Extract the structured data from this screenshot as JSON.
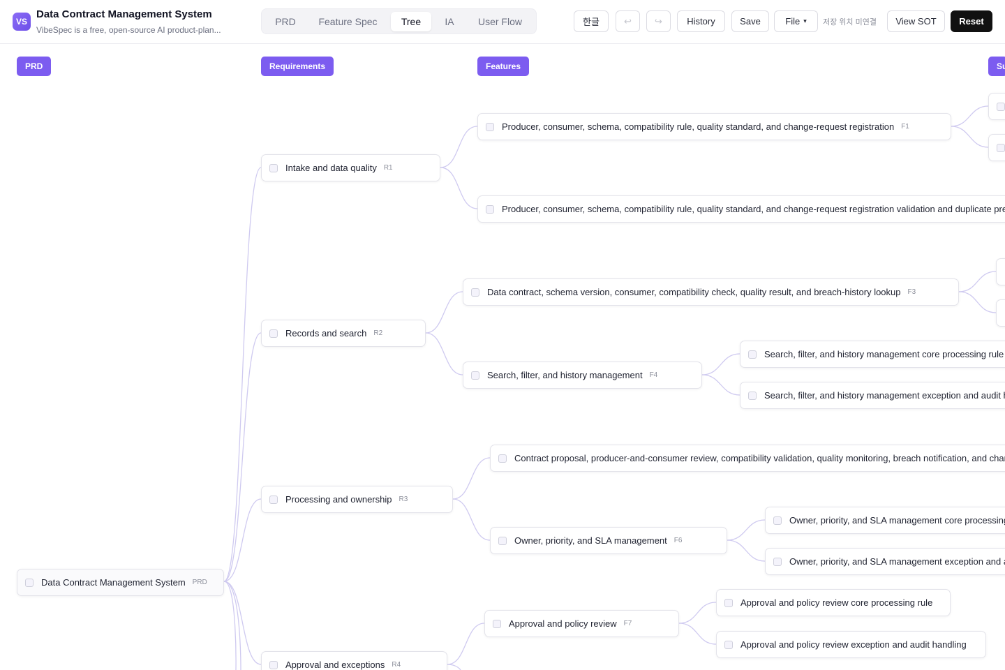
{
  "app": {
    "logo_text": "VS",
    "title": "Data Contract Management System",
    "subtitle": "VibeSpec is a free, open-source AI product-plan..."
  },
  "tabs": [
    {
      "label": "PRD"
    },
    {
      "label": "Feature Spec"
    },
    {
      "label": "Tree",
      "active": true
    },
    {
      "label": "IA"
    },
    {
      "label": "User Flow"
    }
  ],
  "toolbar": {
    "language_label": "한글",
    "undo_icon": "↩",
    "redo_icon": "↪",
    "history_label": "History",
    "save_label": "Save",
    "file_label": "File",
    "file_caret": "▾",
    "save_location_status": "저장 위치 미연결",
    "view_sot_label": "View SOT",
    "reset_label": "Reset"
  },
  "columns": {
    "prd": "PRD",
    "requirements": "Requirements",
    "features": "Features",
    "sub": "Su"
  },
  "tree": {
    "root": {
      "label": "Data Contract Management System",
      "tag": "PRD"
    },
    "requirements": [
      {
        "label": "Intake and data quality",
        "tag": "R1"
      },
      {
        "label": "Records and search",
        "tag": "R2"
      },
      {
        "label": "Processing and ownership",
        "tag": "R3"
      },
      {
        "label": "Approval and exceptions",
        "tag": "R4"
      }
    ],
    "features": [
      {
        "label": "Producer, consumer, schema, compatibility rule, quality standard, and change-request registration",
        "tag": "F1"
      },
      {
        "label": "Producer, consumer, schema, compatibility rule, quality standard, and change-request registration validation and duplicate prev",
        "tag": ""
      },
      {
        "label": "Data contract, schema version, consumer, compatibility check, quality result, and breach-history lookup",
        "tag": "F3"
      },
      {
        "label": "Search, filter, and history management",
        "tag": "F4"
      },
      {
        "label": "Contract proposal, producer-and-consumer review, compatibility validation, quality monitoring, breach notification, and char",
        "tag": ""
      },
      {
        "label": "Owner, priority, and SLA management",
        "tag": "F6"
      },
      {
        "label": "Approval and policy review",
        "tag": "F7"
      }
    ],
    "subfeatures": [
      {
        "label": "Search, filter, and history management core processing rule"
      },
      {
        "label": "Search, filter, and history management exception and audit h"
      },
      {
        "label": "Owner, priority, and SLA management core processing"
      },
      {
        "label": "Owner, priority, and SLA management exception and au"
      },
      {
        "label": "Approval and policy review core processing rule"
      },
      {
        "label": "Approval and policy review exception and audit handling"
      }
    ]
  }
}
